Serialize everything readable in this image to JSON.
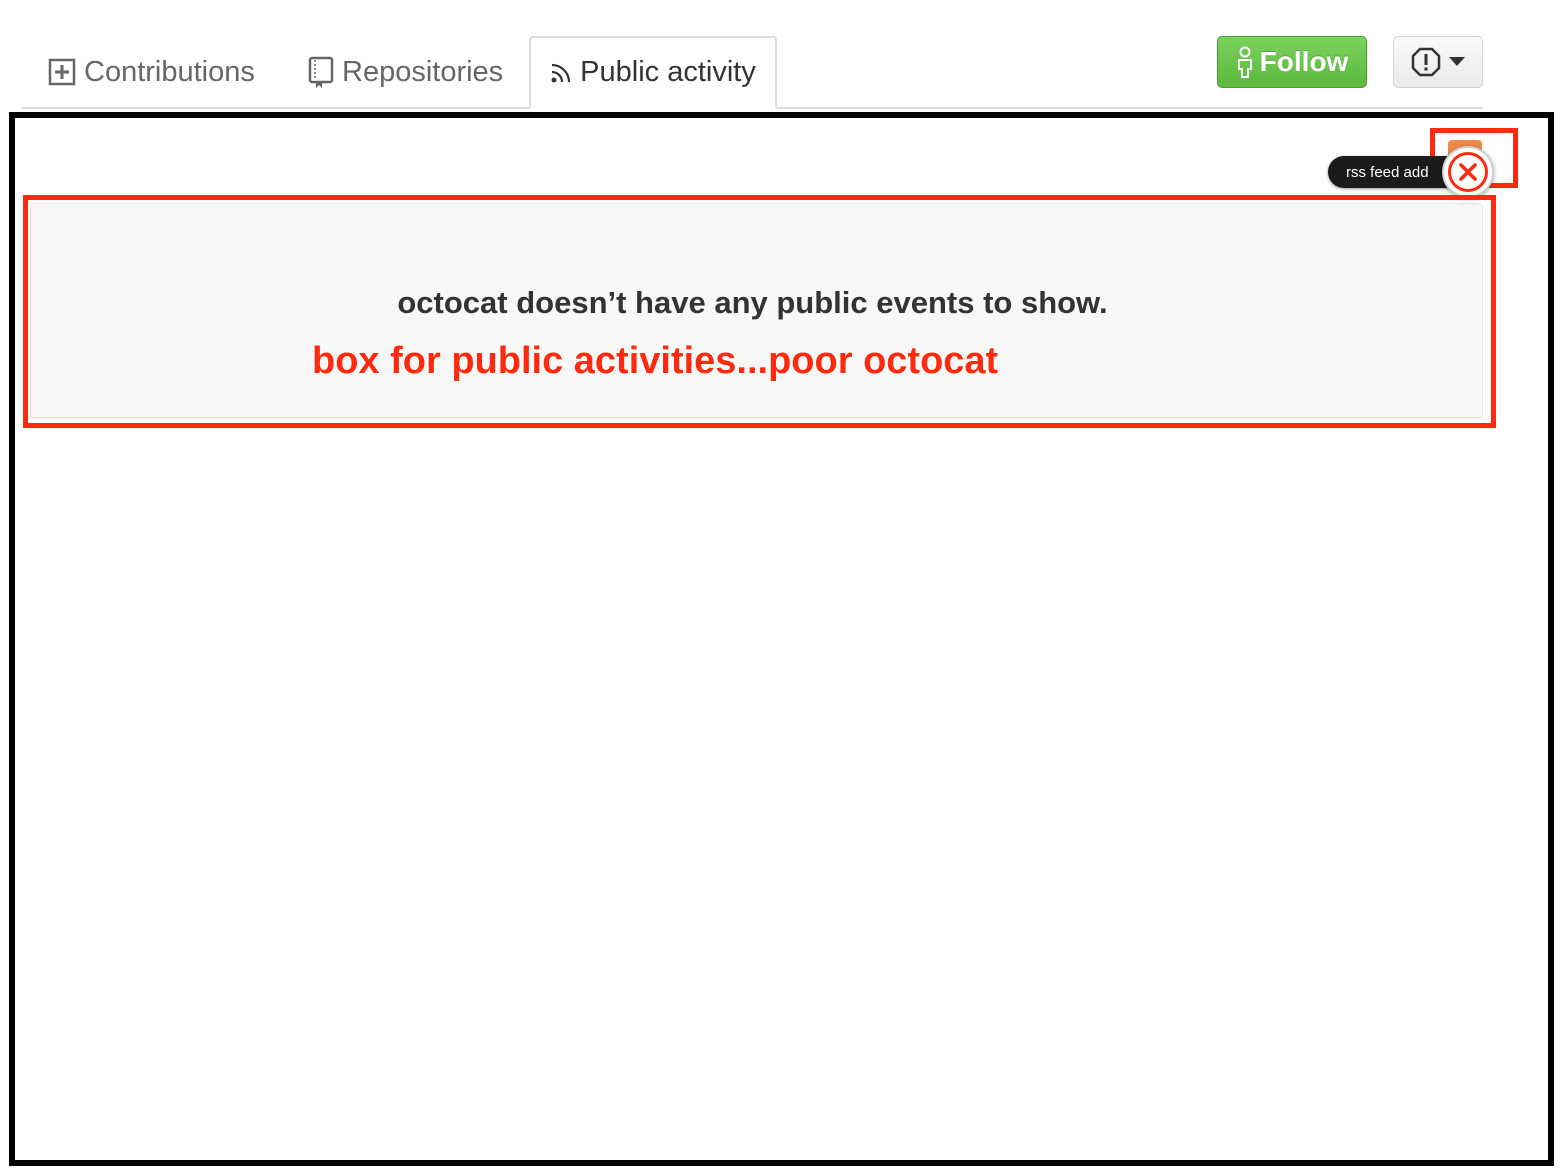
{
  "tabs": {
    "contributions": "Contributions",
    "repositories": "Repositories",
    "public_activity": "Public activity"
  },
  "actions": {
    "follow_label": "Follow",
    "report_icon": "alert-icon"
  },
  "activity": {
    "empty_message": "octocat doesn’t have any public events to show."
  },
  "annotations": {
    "box_note": "box for public activities...poor octocat",
    "tooltip": "rss feed add"
  },
  "colors": {
    "annotation": "#ff2a0d",
    "follow_green": "#5cb83f",
    "rss_orange": "#f08a4b"
  }
}
